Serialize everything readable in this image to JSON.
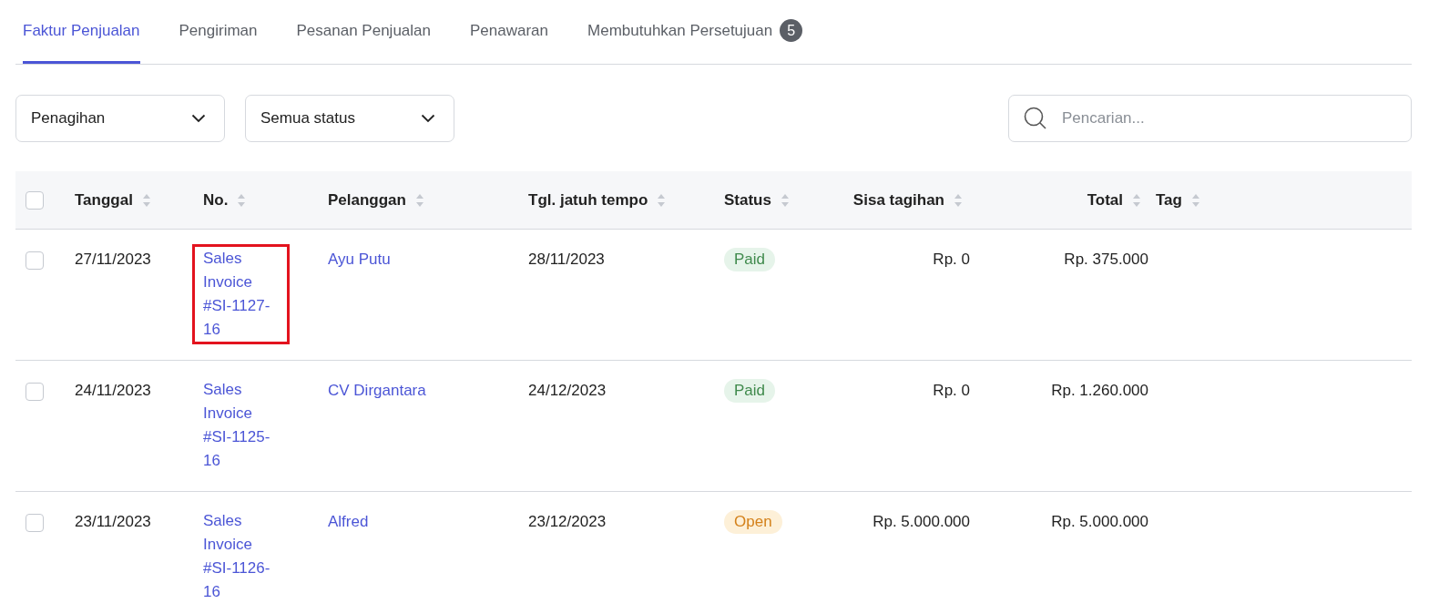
{
  "tabs": [
    {
      "label": "Faktur Penjualan",
      "selected": true
    },
    {
      "label": "Pengiriman",
      "selected": false
    },
    {
      "label": "Pesanan Penjualan",
      "selected": false
    },
    {
      "label": "Penawaran",
      "selected": false
    },
    {
      "label": "Membutuhkan Persetujuan",
      "selected": false,
      "badge": "5"
    }
  ],
  "filters": [
    {
      "value": "Penagihan"
    },
    {
      "value": "Semua status"
    }
  ],
  "search": {
    "placeholder": "Pencarian..."
  },
  "table": {
    "select_all": {
      "checked": false
    },
    "columns": [
      {
        "label": "Tanggal"
      },
      {
        "label": "No."
      },
      {
        "label": "Pelanggan"
      },
      {
        "label": "Tgl. jatuh tempo"
      },
      {
        "label": "Status"
      },
      {
        "label": "Sisa tagihan"
      },
      {
        "label": "Total"
      },
      {
        "label": "Tag"
      }
    ],
    "rows": [
      {
        "checked": false,
        "date": "27/11/2023",
        "number": "Sales Invoice #SI-1127-16",
        "highlighted": true,
        "customer": "Ayu Putu",
        "due_date": "28/11/2023",
        "status": "Paid",
        "kind": "paid",
        "remaining": "Rp. 0",
        "total": "Rp. 375.000"
      },
      {
        "checked": false,
        "date": "24/11/2023",
        "number": "Sales Invoice #SI-1125-16",
        "highlighted": false,
        "customer": "CV Dirgantara",
        "due_date": "24/12/2023",
        "status": "Paid",
        "kind": "paid",
        "remaining": "Rp. 0",
        "total": "Rp. 1.260.000"
      },
      {
        "checked": false,
        "date": "23/11/2023",
        "number": "Sales Invoice #SI-1126-16",
        "highlighted": false,
        "customer": "Alfred",
        "due_date": "23/12/2023",
        "status": "Open",
        "kind": "open",
        "remaining": "Rp. 5.000.000",
        "total": "Rp. 5.000.000"
      }
    ]
  }
}
